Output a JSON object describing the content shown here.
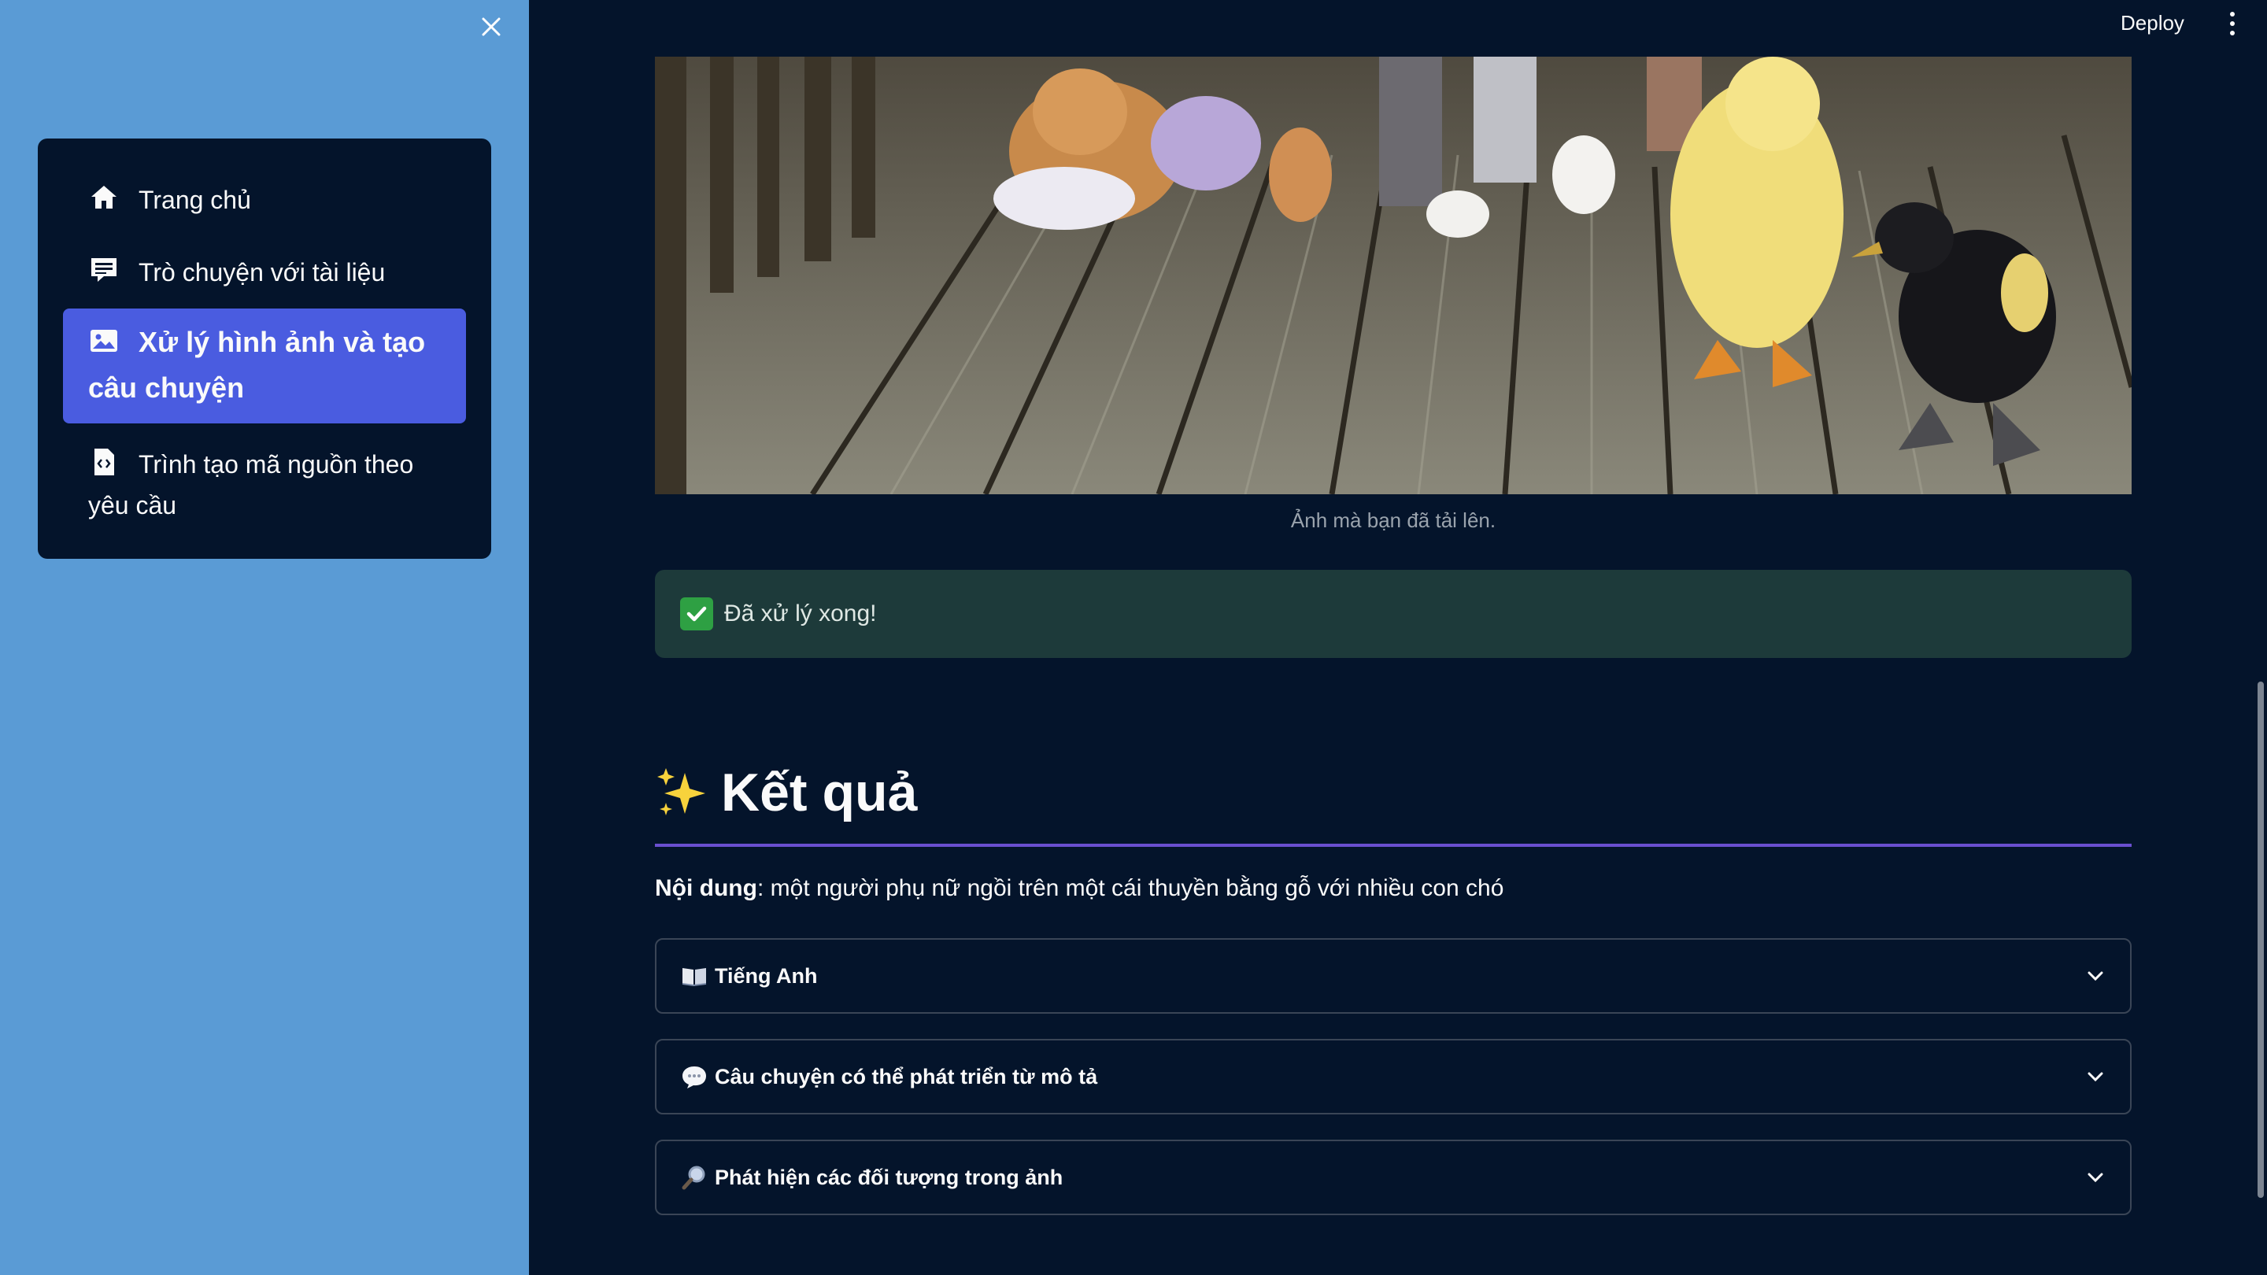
{
  "sidebar": {
    "close_icon": "close-icon",
    "items": [
      {
        "label": "Trang chủ",
        "icon": "home-icon",
        "active": false
      },
      {
        "label": "Trò chuyện với tài liệu",
        "icon": "chat-icon",
        "active": false
      },
      {
        "label": "Xử lý hình ảnh và tạo câu chuyện",
        "icon": "image-icon",
        "active": true
      },
      {
        "label": "Trình tạo mã nguồn theo yêu cầu",
        "icon": "code-file-icon",
        "active": false
      }
    ]
  },
  "header": {
    "deploy_label": "Deploy",
    "menu_icon": "more-vertical-icon"
  },
  "main": {
    "image_caption": "Ảnh mà bạn đã tải lên.",
    "success_message": "Đã xử lý xong!",
    "results_heading": "Kết quả",
    "content_label": "Nội dung",
    "content_text": ": một người phụ nữ ngồi trên một cái thuyền bằng gỗ với nhiều con chó",
    "expanders": [
      {
        "label": "Tiếng Anh",
        "icon": "book-icon"
      },
      {
        "label": "Câu chuyện có thể phát triển từ mô tả",
        "icon": "speech-bubble-icon"
      },
      {
        "label": "Phát hiện các đối tượng trong ảnh",
        "icon": "magnifier-icon"
      }
    ]
  },
  "colors": {
    "sidebar_bg": "#5a9bd5",
    "app_bg": "#04142b",
    "active_nav": "#4a5ce0",
    "success_bg": "#1d3a3a",
    "heading_rule": "#6a4fd0"
  }
}
